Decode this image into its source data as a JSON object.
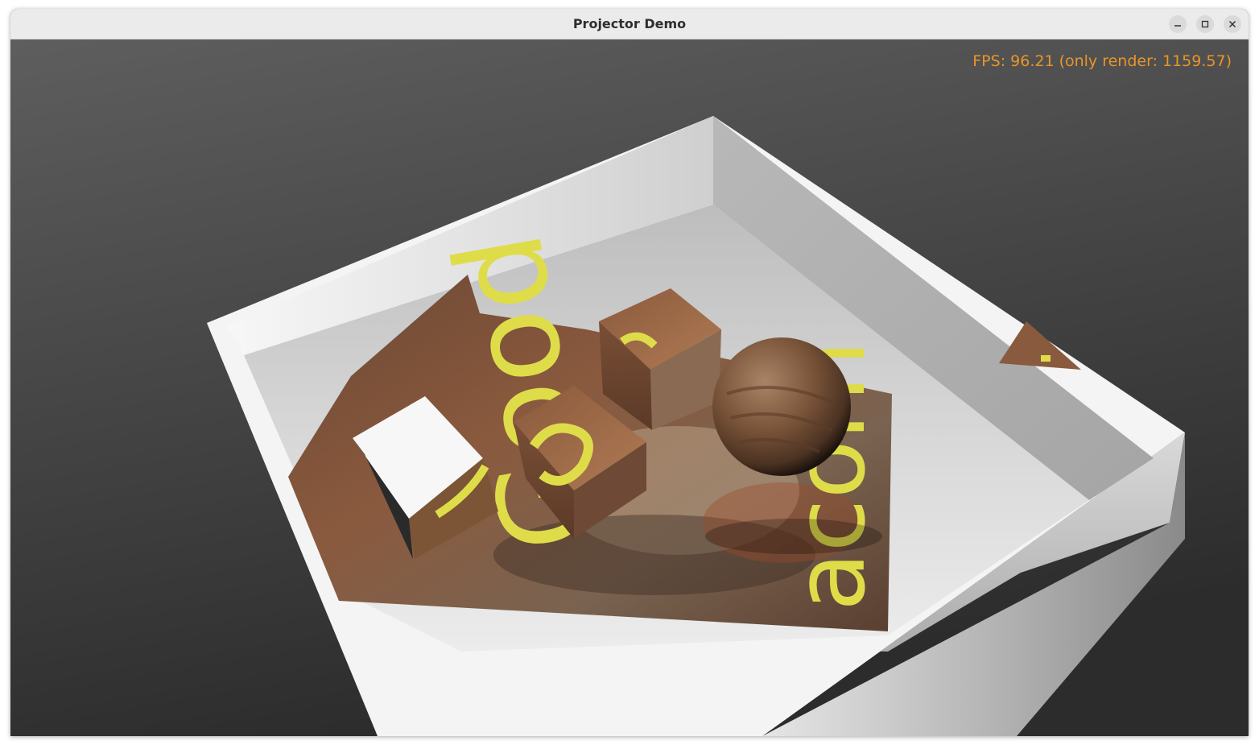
{
  "window": {
    "title": "Projector Demo",
    "controls": {
      "minimize_icon": "minimize-icon",
      "maximize_icon": "maximize-icon",
      "close_icon": "close-icon"
    }
  },
  "overlay": {
    "fps_text": "FPS: 96.21 (only render: 1159.57)",
    "fps_color": "#e8952a"
  },
  "scene": {
    "projected_texture_text": [
      "Good",
      "acorn"
    ],
    "text_color": "#dfdc4a"
  },
  "colors": {
    "titlebar_bg": "#ebebeb",
    "viewport_bg_top": "#5a5a5a",
    "viewport_bg_bottom": "#2f2f2f",
    "box_white": "#f4f4f4"
  }
}
